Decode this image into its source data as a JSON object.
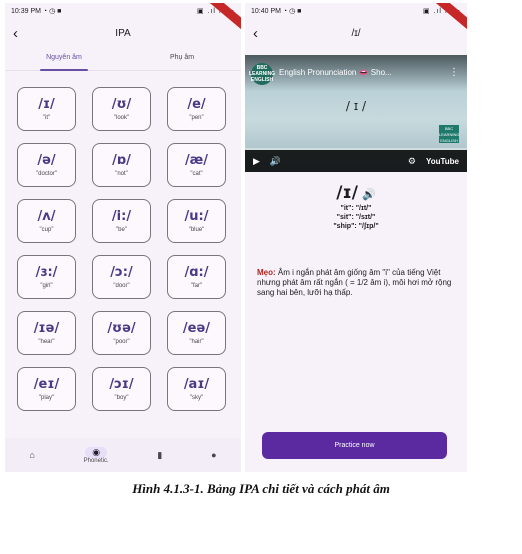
{
  "colors": {
    "accent": "#6750a4",
    "symbol": "#4a3a86",
    "button": "#5b2aa0",
    "tip_label": "#b3261e"
  },
  "left_screen": {
    "status_time": "10:39 PM",
    "status_icons": "◔ ◷ ■",
    "status_sys": "▣ .ıl ıl ▭",
    "back_icon": "‹",
    "title": "IPA",
    "tabs": [
      {
        "label": "Nguyên âm",
        "active": true
      },
      {
        "label": "Phụ âm",
        "active": false
      }
    ],
    "cards": [
      {
        "symbol": "/ɪ/",
        "example": "\"it\""
      },
      {
        "symbol": "/ʊ/",
        "example": "\"look\""
      },
      {
        "symbol": "/e/",
        "example": "\"pen\""
      },
      {
        "symbol": "/ə/",
        "example": "\"doctor\""
      },
      {
        "symbol": "/ɒ/",
        "example": "\"not\""
      },
      {
        "symbol": "/æ/",
        "example": "\"cat\""
      },
      {
        "symbol": "/ʌ/",
        "example": "\"cup\""
      },
      {
        "symbol": "/i:/",
        "example": "\"be\""
      },
      {
        "symbol": "/u:/",
        "example": "\"blue\""
      },
      {
        "symbol": "/ɜ:/",
        "example": "\"girl\""
      },
      {
        "symbol": "/ɔ:/",
        "example": "\"door\""
      },
      {
        "symbol": "/ɑ:/",
        "example": "\"far\""
      },
      {
        "symbol": "/ɪə/",
        "example": "\"hear\""
      },
      {
        "symbol": "/ʊə/",
        "example": "\"poor\""
      },
      {
        "symbol": "/eə/",
        "example": "\"hair\""
      },
      {
        "symbol": "/eɪ/",
        "example": "\"play\""
      },
      {
        "symbol": "/ɔɪ/",
        "example": "\"boy\""
      },
      {
        "symbol": "/aɪ/",
        "example": "\"sky\""
      }
    ],
    "bottom_nav": [
      {
        "icon": "home-icon",
        "glyph": "⌂",
        "label": "",
        "active": false
      },
      {
        "icon": "phonetic-icon",
        "glyph": "◉",
        "label": "Phonetic.",
        "active": true
      },
      {
        "icon": "bookmark-icon",
        "glyph": "▮",
        "label": "",
        "active": false
      },
      {
        "icon": "person-icon",
        "glyph": "●",
        "label": "",
        "active": false
      }
    ]
  },
  "right_screen": {
    "status_time": "10:40 PM",
    "status_icons": "◔ ◷ ■",
    "status_sys": "▣ .ıl ıl ▭",
    "back_icon": "‹",
    "title": "/ɪ/",
    "video": {
      "channel": "BBC LEARNING ENGLISH",
      "title": "English Pronunciation 👄 Sho...",
      "center_text": "/ ɪ /",
      "logo": "BBC LEARNING ENGLISH",
      "play_icon": "▶",
      "volume_icon": "🔊",
      "settings_icon": "⚙",
      "brand": "YouTube"
    },
    "symbol": "/ɪ/",
    "speaker_icon": "🔊",
    "examples": [
      "\"it\": \"/ɪt/\"",
      "\"sit\": \"/sɪt/\"",
      "\"ship\": \"/ʃɪp/\""
    ],
    "tip_label": "Mẹo:",
    "tip_text": " Âm i ngắn phát âm giống âm \"i\" của tiếng Việt nhưng phát âm rất ngắn ( = 1/2 âm i), môi hơi mở rộng sang hai bên, lưỡi hạ thấp.",
    "practice_button": "Practice now"
  },
  "caption": "Hình 4.1.3-1. Bảng IPA chi tiết và cách phát âm"
}
